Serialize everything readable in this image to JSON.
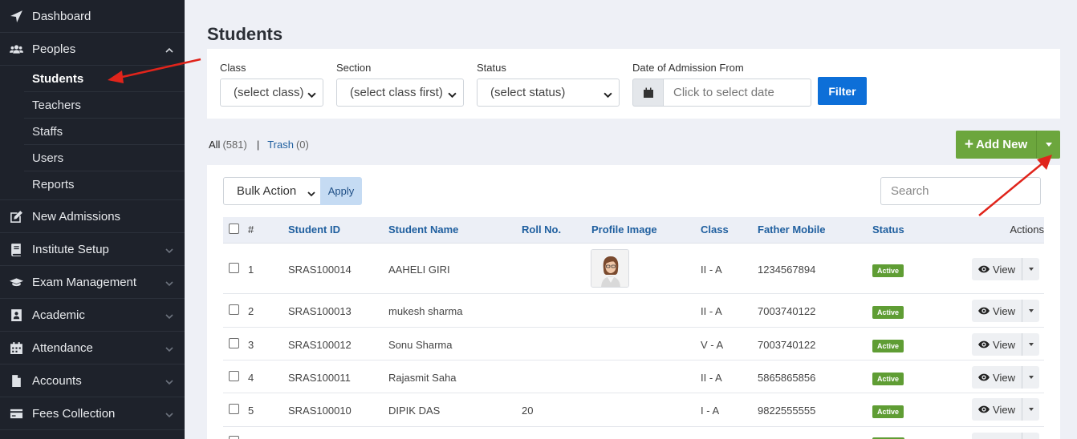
{
  "sidebar": {
    "items": [
      {
        "label": "Dashboard",
        "icon": "location-arrow-icon"
      },
      {
        "label": "Peoples",
        "icon": "users-icon"
      },
      {
        "label": "New Admissions",
        "icon": "edit-icon"
      },
      {
        "label": "Institute Setup",
        "icon": "book-icon"
      },
      {
        "label": "Exam Management",
        "icon": "graduation-cap-icon"
      },
      {
        "label": "Academic",
        "icon": "address-book-icon"
      },
      {
        "label": "Attendance",
        "icon": "calendar-icon"
      },
      {
        "label": "Accounts",
        "icon": "file-icon"
      },
      {
        "label": "Fees Collection",
        "icon": "credit-card-icon"
      }
    ],
    "peoples_submenu": [
      "Students",
      "Teachers",
      "Staffs",
      "Users",
      "Reports"
    ],
    "active_submenu": "Students"
  },
  "page": {
    "title": "Students"
  },
  "filters": {
    "class_label": "Class",
    "class_value": "(select class)",
    "section_label": "Section",
    "section_value": "(select class first)",
    "status_label": "Status",
    "status_value": "(select status)",
    "date_label": "Date of Admission From",
    "date_placeholder": "Click to select date",
    "filter_button": "Filter"
  },
  "counts": {
    "all_label": "All",
    "all_count": "(581)",
    "separator": "|",
    "trash_label": "Trash",
    "trash_count": "(0)"
  },
  "add_new": {
    "label": "Add New",
    "plus": "+"
  },
  "toolbar": {
    "bulk_action": "Bulk Action",
    "apply": "Apply",
    "search_placeholder": "Search"
  },
  "table": {
    "headers": {
      "num": "#",
      "student_id": "Student ID",
      "student_name": "Student Name",
      "roll_no": "Roll No.",
      "profile_image": "Profile Image",
      "class": "Class",
      "father_mobile": "Father Mobile",
      "status": "Status",
      "actions": "Actions"
    },
    "rows": [
      {
        "num": "1",
        "id": "SRAS100014",
        "name": "AAHELI GIRI",
        "roll": "",
        "class": "II - A",
        "mobile": "1234567894",
        "status": "Active",
        "action": "View"
      },
      {
        "num": "2",
        "id": "SRAS100013",
        "name": "mukesh sharma",
        "roll": "",
        "class": "II - A",
        "mobile": "7003740122",
        "status": "Active",
        "action": "View"
      },
      {
        "num": "3",
        "id": "SRAS100012",
        "name": "Sonu Sharma",
        "roll": "",
        "class": "V - A",
        "mobile": "7003740122",
        "status": "Active",
        "action": "View"
      },
      {
        "num": "4",
        "id": "SRAS100011",
        "name": "Rajasmit Saha",
        "roll": "",
        "class": "II - A",
        "mobile": "5865865856",
        "status": "Active",
        "action": "View"
      },
      {
        "num": "5",
        "id": "SRAS100010",
        "name": "DIPIK DAS",
        "roll": "20",
        "class": "I - A",
        "mobile": "9822555555",
        "status": "Active",
        "action": "View"
      }
    ]
  },
  "colors": {
    "sidebar_bg": "#1e222b",
    "primary": "#0d6fd8",
    "success": "#6ca63d",
    "annotation_arrow": "#e0241b"
  }
}
